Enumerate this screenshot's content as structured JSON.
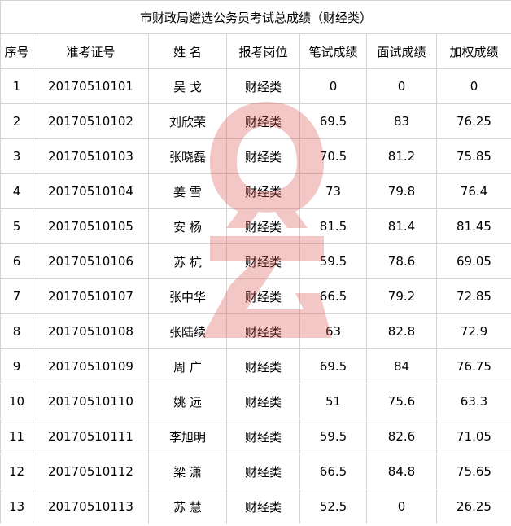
{
  "title": "市财政局遴选公务员考试总成绩（财经类）",
  "headers": [
    "序号",
    "准考证号",
    "姓 名",
    "报考岗位",
    "笔试成绩",
    "面试成绩",
    "加权成绩"
  ],
  "rows": [
    [
      "1",
      "20170510101",
      "吴 戈",
      "财经类",
      "0",
      "0",
      "0"
    ],
    [
      "2",
      "20170510102",
      "刘欣荣",
      "财经类",
      "69.5",
      "83",
      "76.25"
    ],
    [
      "3",
      "20170510103",
      "张晓磊",
      "财经类",
      "70.5",
      "81.2",
      "75.85"
    ],
    [
      "4",
      "20170510104",
      "姜 雪",
      "财经类",
      "73",
      "79.8",
      "76.4"
    ],
    [
      "5",
      "20170510105",
      "安 杨",
      "财经类",
      "81.5",
      "81.4",
      "81.45"
    ],
    [
      "6",
      "20170510106",
      "苏 杭",
      "财经类",
      "59.5",
      "78.6",
      "69.05"
    ],
    [
      "7",
      "20170510107",
      "张中华",
      "财经类",
      "66.5",
      "79.2",
      "72.85"
    ],
    [
      "8",
      "20170510108",
      "张陆续",
      "财经类",
      "63",
      "82.8",
      "72.9"
    ],
    [
      "9",
      "20170510109",
      "周 广",
      "财经类",
      "69.5",
      "84",
      "76.75"
    ],
    [
      "10",
      "20170510110",
      "姚 远",
      "财经类",
      "51",
      "75.6",
      "63.3"
    ],
    [
      "11",
      "20170510111",
      "李旭明",
      "财经类",
      "59.5",
      "82.6",
      "71.05"
    ],
    [
      "12",
      "20170510112",
      "梁 潇",
      "财经类",
      "66.5",
      "84.8",
      "75.65"
    ],
    [
      "13",
      "20170510113",
      "苏 慧",
      "财经类",
      "52.5",
      "0",
      "26.25"
    ]
  ],
  "colors": {
    "grid": "#d4d4d4",
    "watermark": "#d9534f"
  }
}
